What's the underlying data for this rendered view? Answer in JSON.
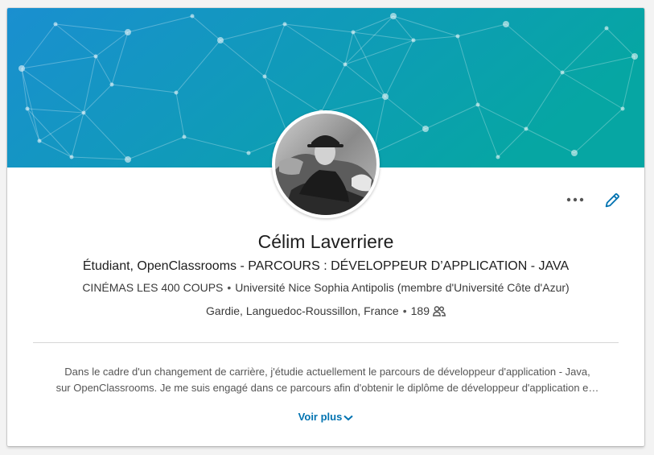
{
  "profile": {
    "name": "Célim Laverriere",
    "headline": "Étudiant, OpenClassrooms - PARCOURS : DÉVELOPPEUR D’APPLICATION - JAVA",
    "company": "CINÉMAS LES 400 COUPS",
    "separator": "•",
    "school": "Université Nice Sophia Antipolis (membre d'Université Côte d'Azur)",
    "location": "Gardie, Languedoc-Roussillon, France",
    "connections": "189"
  },
  "summary": {
    "line1": "Dans le cadre d'un changement de carrière, j'étudie actuellement le parcours de développeur d'application - Java,",
    "line2": "sur OpenClassrooms. Je me suis engagé dans ce parcours afin d'obtenir le diplôme de développeur d'application e…"
  },
  "actions": {
    "see_more_label": "Voir plus"
  },
  "icons": {
    "more": "more-horizontal-icon",
    "edit": "pencil-icon",
    "connections": "people-icon",
    "see_more": "chevron-down-icon"
  },
  "colors": {
    "accent": "#0073b1",
    "banner_left": "#1b90c9",
    "banner_right": "#0aa3a6"
  }
}
